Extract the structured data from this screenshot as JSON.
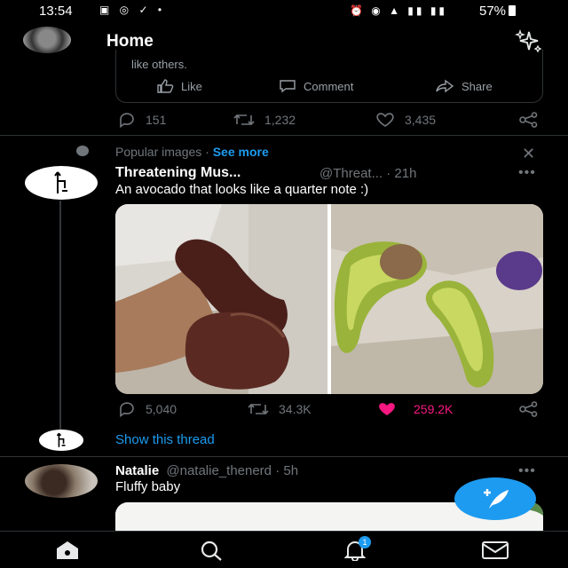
{
  "status_bar": {
    "time": "13:54",
    "battery": "57%"
  },
  "header": {
    "title": "Home"
  },
  "quoted": {
    "text_tail": "like others.",
    "like_label": "Like",
    "comment_label": "Comment",
    "share_label": "Share"
  },
  "prev_tweet": {
    "replies": "151",
    "retweets": "1,232",
    "likes": "3,435"
  },
  "popular": {
    "label": "Popular images · ",
    "see_more": "See more"
  },
  "tweet": {
    "name": "Threatening Mus...",
    "handle": "@Threat... · 21h",
    "text": "An avocado that looks like a quarter note :)",
    "replies": "5,040",
    "retweets": "34.3K",
    "likes": "259.2K",
    "show_thread": "Show this thread"
  },
  "next_tweet": {
    "name": "Natalie",
    "handle": "@natalie_thenerd · 5h",
    "text": "Fluffy baby"
  },
  "nav": {
    "notifications_badge": "1"
  },
  "colors": {
    "accent": "#1d9bf0",
    "like": "#f91880",
    "muted": "#71767b"
  }
}
